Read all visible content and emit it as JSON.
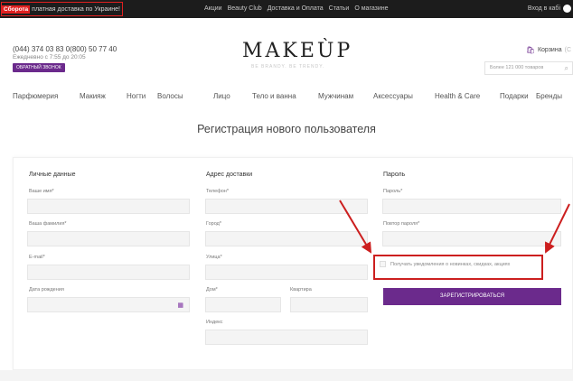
{
  "topbar": {
    "promo_badge": "Сборота",
    "promo_text": "платная доставка по Украине!",
    "links": [
      "Акции",
      "Beauty Club",
      "Доставка и Оплата",
      "Статьи",
      "О магазине"
    ],
    "login": "Вход в кабі"
  },
  "header": {
    "phone": "(044) 374 03 83  0(800) 50 77 40",
    "hours": "Ежедневно с 7:55 до 20:05",
    "callback": "ОБРАТНЫЙ ЗВОНОК",
    "logo": "MAKEÙP",
    "slogan": "BE BRANDY. BE TRENDY.",
    "cart_label": "Корзина",
    "cart_count": "(С",
    "search_placeholder": "Более 121 000 товаров"
  },
  "nav": {
    "items": [
      "Парфюмерия",
      "Макияж",
      "Ногти",
      "Волосы",
      "Лицо",
      "Тело и ванна",
      "Мужчинам",
      "Аксессуары",
      "Health & Care",
      "Подарки",
      "Бренды"
    ]
  },
  "page": {
    "title": "Регистрация нового пользователя"
  },
  "form": {
    "personal": {
      "title": "Личные данные",
      "first_name": "Ваше имя*",
      "last_name": "Ваша фамилия*",
      "email": "E-mail*",
      "birthday": "Дата рождения"
    },
    "address": {
      "title": "Адрес доставки",
      "phone": "Телефон*",
      "city": "Город*",
      "street": "Улица*",
      "house": "Дом*",
      "apartment": "Квартира",
      "zip": "Индекс"
    },
    "password": {
      "title": "Пароль",
      "password": "Пароль*",
      "repeat": "Повтор пароля*",
      "subscribe": "Получать уведомления о новинках, скидках, акциях",
      "submit": "ЗАРЕГИСТРИРОВАТЬСЯ"
    }
  },
  "colors": {
    "accent": "#6b2a8c",
    "highlight": "#cc1f1f"
  }
}
